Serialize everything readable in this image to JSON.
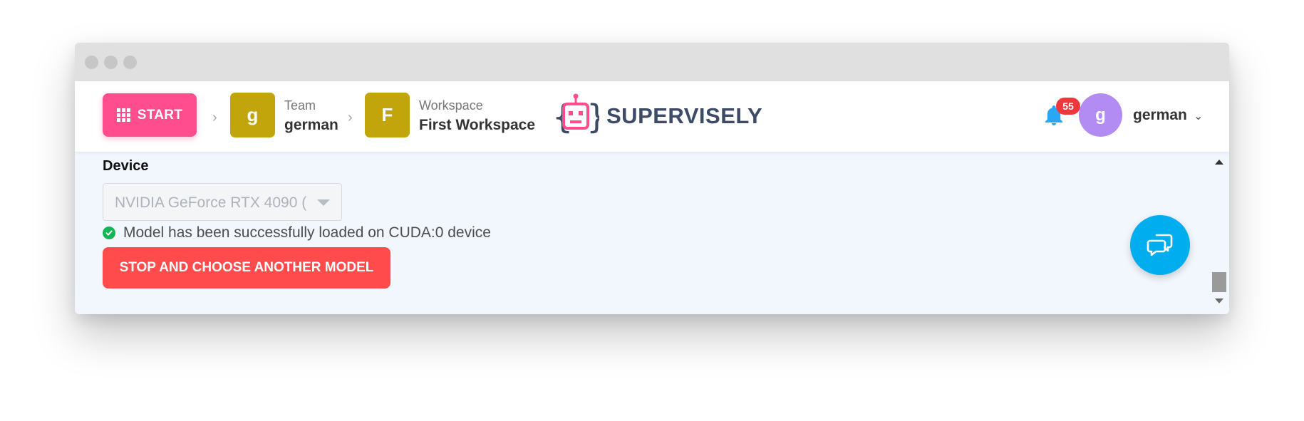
{
  "header": {
    "start_label": "START",
    "team_caption": "Team",
    "team_name": "german",
    "team_initial": "g",
    "workspace_caption": "Workspace",
    "workspace_name": "First Workspace",
    "workspace_initial": "F",
    "logo_text": "SUPERVISELY",
    "notification_count": "55",
    "user_initial": "g",
    "user_name": "german"
  },
  "content": {
    "device_label": "Device",
    "device_value": "NVIDIA GeForce RTX 4090 (",
    "status_text": "Model has been successfully loaded on CUDA:0 device",
    "stop_button_label": "STOP AND CHOOSE ANOTHER MODEL"
  },
  "colors": {
    "start_button": "#ff4d8d",
    "tile": "#c1a50a",
    "avatar": "#b28cf3",
    "badge": "#f0373c",
    "stop_button": "#ff4b4b",
    "chat_button": "#00adef",
    "success": "#13b655",
    "logo_text": "#3d4a68"
  },
  "icons": [
    "grid-icon",
    "chevron-right-icon",
    "robot-logo-icon",
    "bell-icon",
    "chevron-down-icon",
    "check-circle-icon",
    "chat-icon"
  ]
}
